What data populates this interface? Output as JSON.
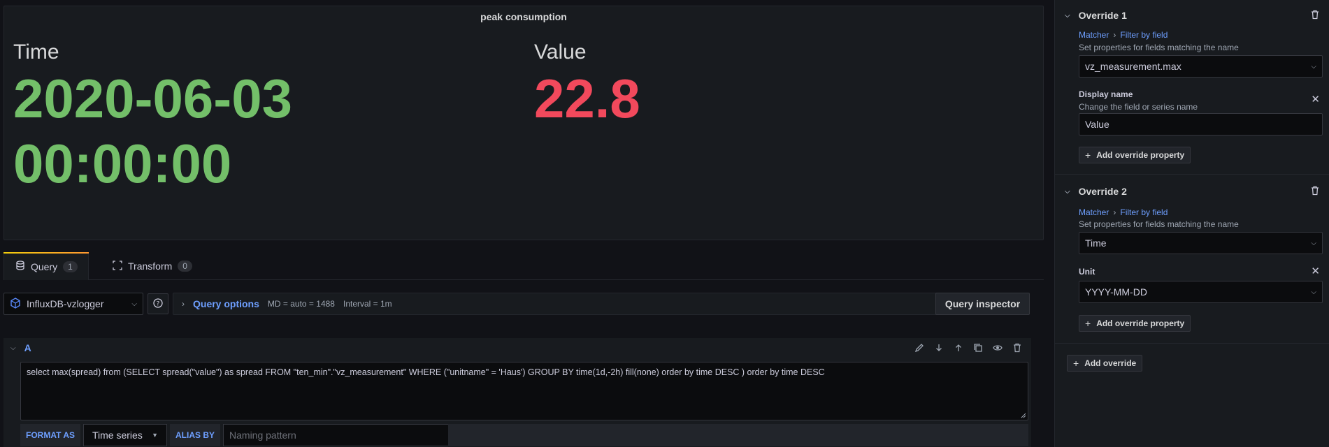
{
  "panel": {
    "title": "peak consumption",
    "time": {
      "name": "Time",
      "date": "2020-06-03",
      "clock": "00:00:00"
    },
    "value": {
      "name": "Value",
      "number": "22.8"
    }
  },
  "tabs": [
    {
      "label": "Query",
      "count": "1",
      "icon": "database-icon"
    },
    {
      "label": "Transform",
      "count": "0",
      "icon": "transform-icon"
    }
  ],
  "toolbar": {
    "datasource": "InfluxDB-vzlogger",
    "query_options_label": "Query options",
    "md": "MD = auto = 1488",
    "interval": "Interval = 1m",
    "inspector_label": "Query inspector"
  },
  "query": {
    "ref": "A",
    "text": "select max(spread) from (SELECT spread(\"value\") as spread FROM \"ten_min\".\"vz_measurement\" WHERE (\"unitname\" = 'Haus') GROUP BY time(1d,-2h) fill(none) order by time DESC ) order by time DESC",
    "format_label": "FORMAT AS",
    "format_value": "Time series",
    "alias_label": "ALIAS BY",
    "alias_placeholder": "Naming pattern"
  },
  "overrides": [
    {
      "title": "Override 1",
      "matcher_label": "Matcher",
      "matcher_value": "Filter by field",
      "matcher_desc": "Set properties for fields matching the name",
      "field": "vz_measurement.max",
      "prop_title": "Display name",
      "prop_desc": "Change the field or series name",
      "prop_value": "Value",
      "add_prop": "Add override property"
    },
    {
      "title": "Override 2",
      "matcher_label": "Matcher",
      "matcher_value": "Filter by field",
      "matcher_desc": "Set properties for fields matching the name",
      "field": "Time",
      "prop_title": "Unit",
      "prop_value": "YYYY-MM-DD",
      "add_prop": "Add override property"
    }
  ],
  "add_override": "Add override",
  "colors": {
    "green": "#73bf69",
    "red": "#f2495c",
    "link": "#6e9fff",
    "bg": "#111217",
    "panel": "#181b1f"
  }
}
